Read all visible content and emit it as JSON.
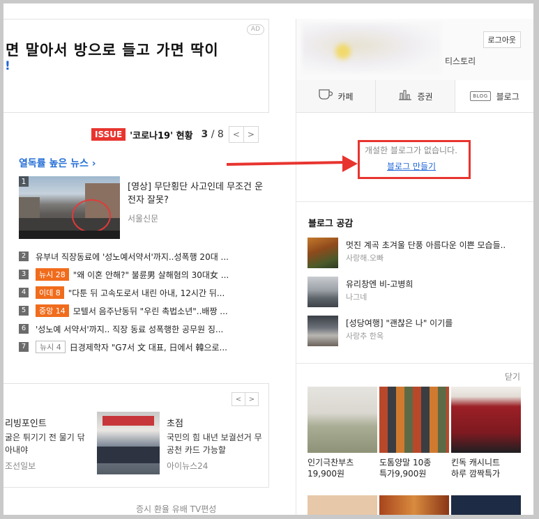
{
  "ad": {
    "badge": "AD",
    "title": "면 말아서 방으로 들고 가면 딱이",
    "subtitle": "!"
  },
  "issue": {
    "badge": "ISSUE",
    "topic": "'코로나19' 현황",
    "current": "3",
    "separator": " / ",
    "total": "8",
    "prev": "<",
    "next": ">"
  },
  "popular": {
    "title": "열독률 높은 뉴스 ›",
    "headline": {
      "rank": "1",
      "title": "[영상] 무단횡단 사고인데 무조건 운전자 잘못?",
      "source": "서울신문"
    },
    "items": [
      {
        "rank": "2",
        "tag": "",
        "title": "유부녀 직장동료에 '성노예서약서'까지..성폭행 20대 ..."
      },
      {
        "rank": "3",
        "tag": "뉴시 28",
        "title": "\"왜 이혼 안해?\" 불륜男 살해혐의 30대女 ..."
      },
      {
        "rank": "4",
        "tag": "이데 8",
        "title": "\"다툰 뒤 고속도로서 내린 아내, 12시간 뒤..."
      },
      {
        "rank": "5",
        "tag": "중앙 14",
        "title": "모텔서 음주난동뒤 \"우린 촉법소년\"..배짱 ..."
      },
      {
        "rank": "6",
        "tag": "",
        "title": "'성노예 서약서'까지.. 직장 동료 성폭행한 공무원 징..."
      },
      {
        "rank": "7",
        "tag": "뉴시 4",
        "title": "日경제학자 \"G7서 文 대표, 日에서 韓으로..."
      }
    ]
  },
  "sub_news": {
    "prev": "<",
    "next": ">",
    "left": {
      "title": "리빙포인트",
      "desc": "굴은 튀기기 전 물기 닦아내야",
      "source": "조선일보"
    },
    "right": {
      "title": "초점",
      "desc": "국민의 힘 내년 보궐선거 무공천 카드 가능할",
      "source": "아이뉴스24"
    },
    "bottom_tabs": "증시   환율   유배   TV편성"
  },
  "profile": {
    "logout": "로그아웃",
    "service": "티스토리"
  },
  "service_tabs": [
    {
      "icon": "cafe-icon",
      "label": "카페"
    },
    {
      "icon": "stock-icon",
      "label": "증권"
    },
    {
      "icon": "blog-icon",
      "label": "블로그",
      "icon_text": "BLOG"
    }
  ],
  "blog": {
    "empty_message": "개설한 블로그가 없습니다.",
    "create_link": "블로그 만들기",
    "section_title": "블로그 공감",
    "posts": [
      {
        "title": "멋진 계곡 초겨울 단풍 아름다운 이쁜 모습들..",
        "author": "사랑해.오빠"
      },
      {
        "title": "유리창엔 비-고병희",
        "author": "나그네"
      },
      {
        "title": "[성당여행] \"괜찮은 나\" 이기를",
        "author": "사랑추 한옥"
      }
    ]
  },
  "shopping": {
    "close": "닫기",
    "items": [
      {
        "name": "인기극찬부츠",
        "price": "19,900원"
      },
      {
        "name": "도톰양말 10종",
        "price": "특가9,900원"
      },
      {
        "name": "킨독 캐시니트",
        "price": "하루 깜짝특가"
      }
    ]
  },
  "colors": {
    "accent_red": "#e8342f",
    "link_blue": "#1c64d8",
    "hot_tag": "#f06c1c"
  }
}
